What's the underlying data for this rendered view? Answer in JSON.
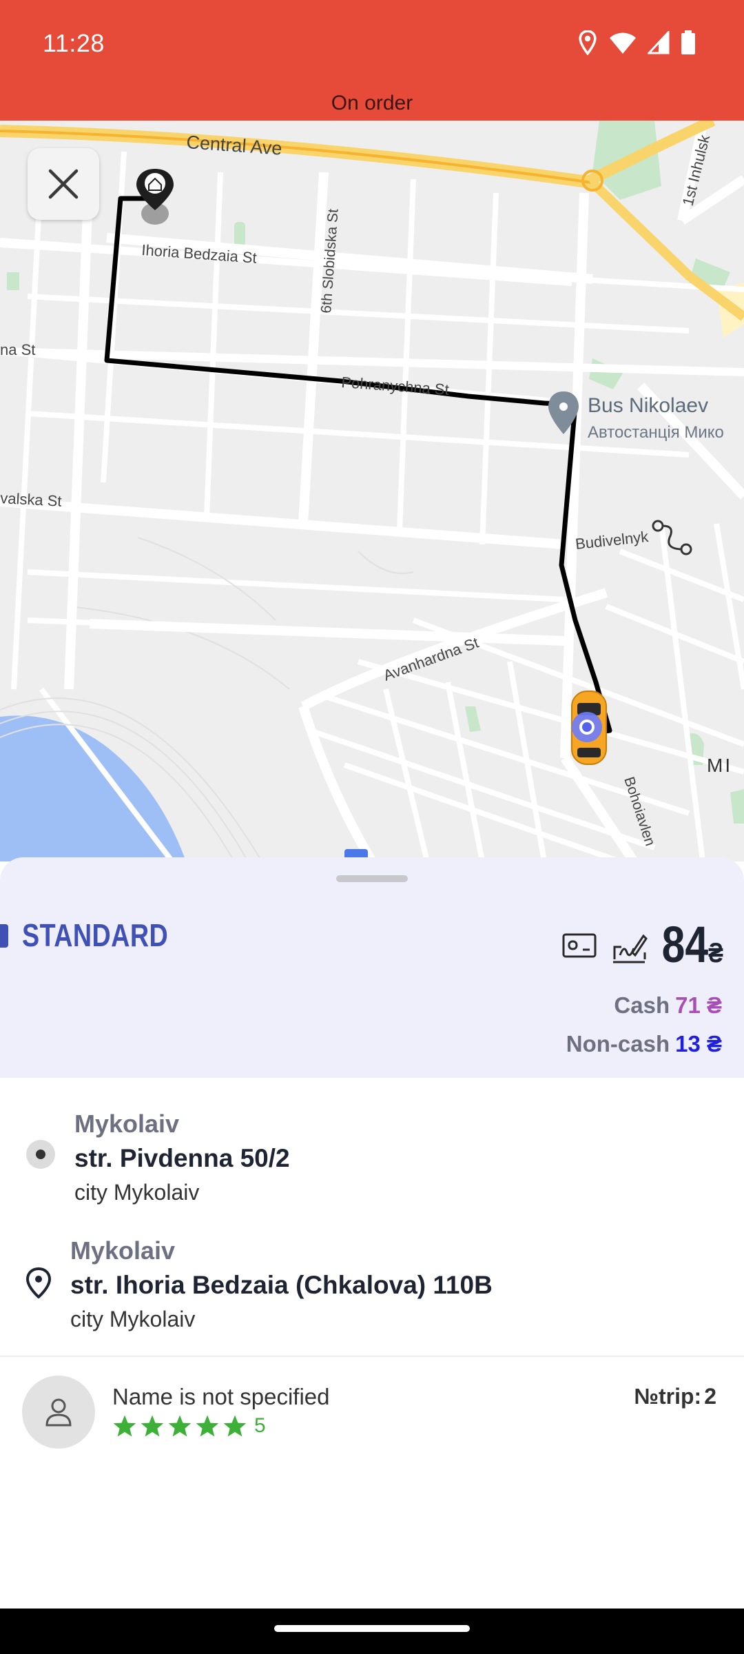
{
  "status_bar": {
    "time": "11:28",
    "icons": [
      "location-icon",
      "wifi-icon",
      "signal-icon",
      "battery-icon"
    ]
  },
  "header": {
    "status_text": "On order"
  },
  "map": {
    "streets": {
      "central_ave": "Central Ave",
      "first_inhulsk": "1st Inhulsk",
      "ihoria_bedzaia": "Ihoria Bedzaia St",
      "sixth_slobidska": "6th Slobidska St",
      "na_st": "na St",
      "pohranychna": "Pohranychna St",
      "valska": "valska St",
      "budivelnykiv": "Budivelnyk",
      "avanhardna": "Avanhardna St",
      "bohoiavlen": "Bohoiavlen",
      "mi": "МІ"
    },
    "poi": {
      "name": "Bus Nikolaev",
      "sub": "Автостанція Мико"
    },
    "close_icon": "close-icon"
  },
  "order": {
    "class_name": "STANDARD",
    "price": "84",
    "price_currency": "₴",
    "cash_label": "Cash",
    "cash_value": "71 ₴",
    "noncash_label": "Non-cash",
    "noncash_value": "13 ₴",
    "colors": {
      "accent": "#3F51B5",
      "cash": "#A64FB5",
      "noncash": "#1F1FE0",
      "header": "#E64A39"
    }
  },
  "route": {
    "pickup": {
      "city_top": "Mykolaiv",
      "street": "str. Pivdenna 50/2",
      "city": "city Mykolaiv"
    },
    "destination": {
      "city_top": "Mykolaiv",
      "street": "str. Ihoria Bedzaia (Chkalova) 110B",
      "city": "city Mykolaiv"
    }
  },
  "driver": {
    "name": "Name is not specified",
    "rating": "5",
    "stars": 5,
    "trip_label": "№trip:",
    "trip_number": "2"
  }
}
